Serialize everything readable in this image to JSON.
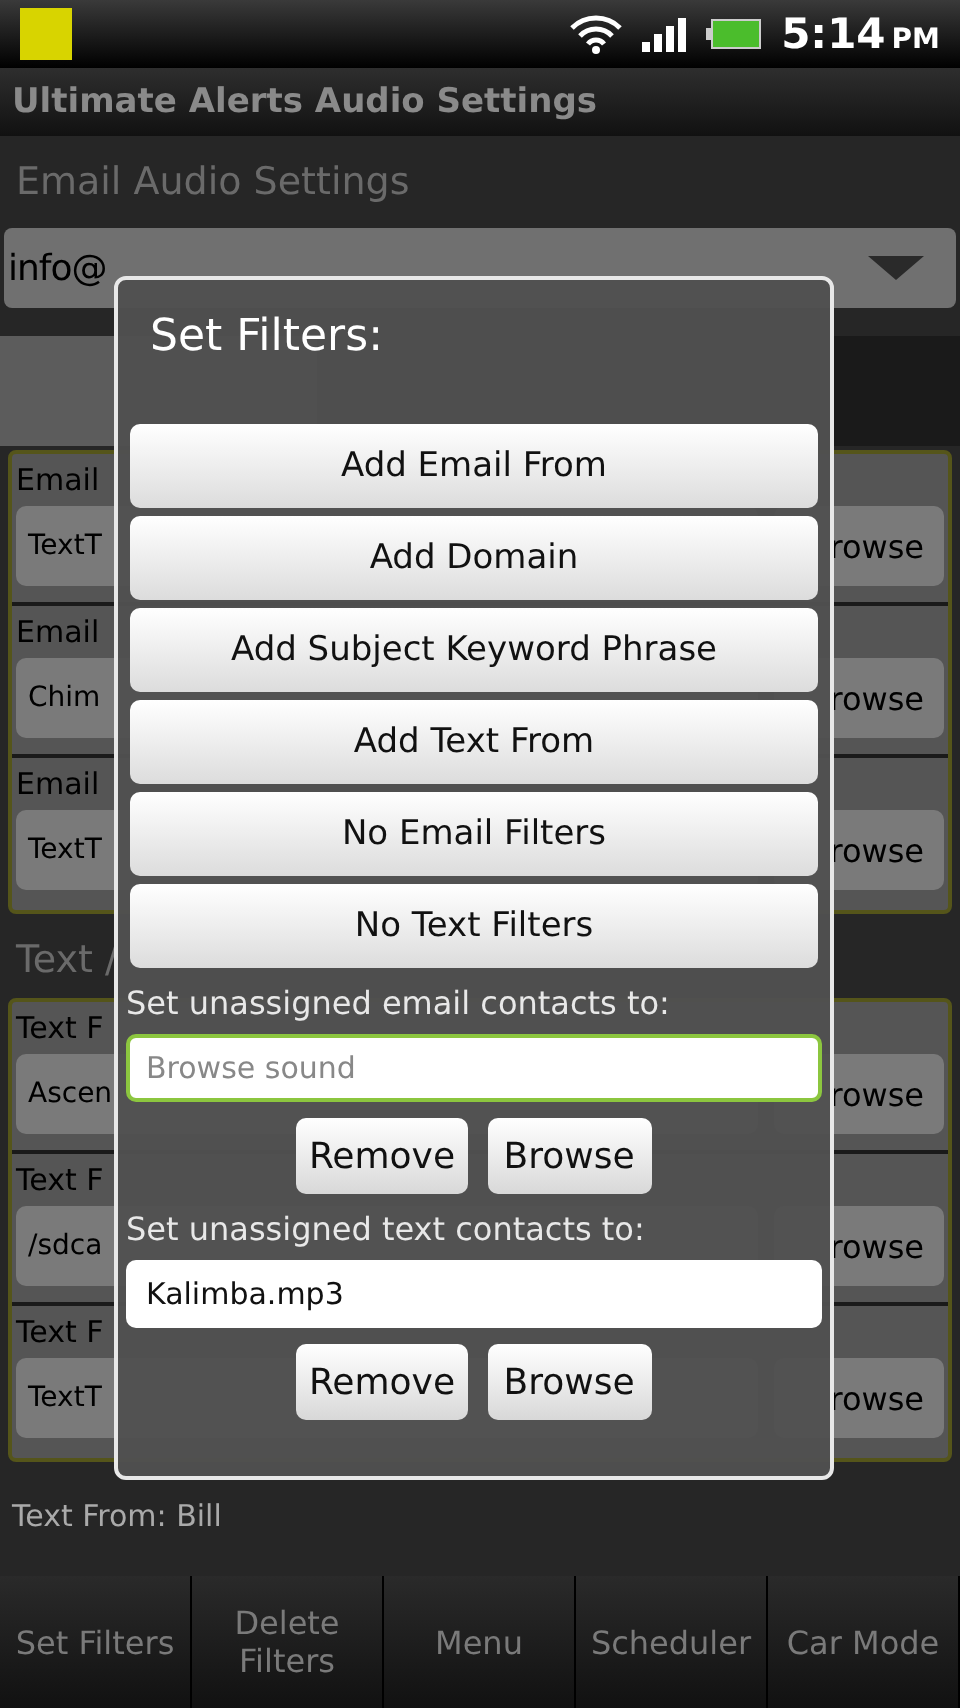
{
  "status_bar": {
    "time": "5:14",
    "meridiem": "PM"
  },
  "title": "Ultimate Alerts Audio Settings",
  "email_section": {
    "heading": "Email Audio Settings",
    "account": "info@",
    "rows": [
      {
        "label": "Email",
        "sound": "TextT",
        "button": "rowse"
      },
      {
        "label": "Email",
        "sound": "Chim",
        "button": "rowse"
      },
      {
        "label": "Email",
        "sound": "TextT",
        "button": "rowse"
      }
    ]
  },
  "text_section": {
    "heading": "Text /",
    "rows": [
      {
        "label": "Text F",
        "sound": "Ascen",
        "button": "rowse"
      },
      {
        "label": "Text F",
        "sound": "/sdca",
        "button": "rowse"
      },
      {
        "label": "Text F",
        "sound": "TextT",
        "button": "rowse"
      }
    ],
    "cut_label": "Text From: Bill"
  },
  "dialog": {
    "title": "Set Filters:",
    "buttons": [
      "Add Email From",
      "Add Domain",
      "Add Subject Keyword Phrase",
      "Add Text From",
      "No Email Filters",
      "No Text Filters"
    ],
    "email_default": {
      "label": "Set unassigned email contacts to:",
      "placeholder": "Browse sound",
      "focused": true,
      "actions": [
        "Remove",
        "Browse"
      ]
    },
    "text_default": {
      "label": "Set unassigned text contacts to:",
      "value": "Kalimba.mp3",
      "focused": false,
      "actions": [
        "Remove",
        "Browse"
      ]
    }
  },
  "bottom_bar": [
    "Set Filters",
    "Delete Filters",
    "Menu",
    "Scheduler",
    "Car Mode"
  ]
}
